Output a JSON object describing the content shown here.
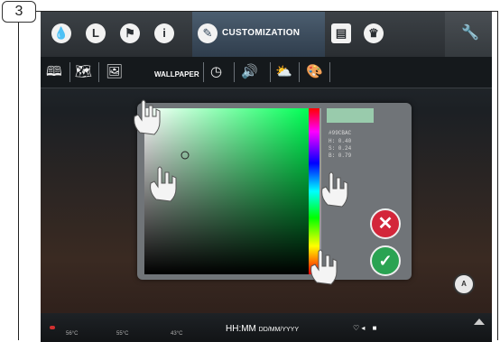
{
  "step": {
    "number": "3"
  },
  "topbar": {
    "tab_label": "CUSTOMIZATION",
    "icons": [
      "water-drop-icon",
      "timer-icon",
      "flag-icon",
      "info-icon",
      "pencil-icon",
      "grid-icon",
      "chef-icon",
      "wrench-icon"
    ]
  },
  "subbar": {
    "wallpaper_label": "WALLPAPER",
    "icons": [
      "book-icon",
      "book-map-icon",
      "wallpaper-icon",
      "clock-icon",
      "speaker-icon",
      "weather-icon",
      "palette-icon"
    ]
  },
  "picker": {
    "hex": "#99CBAC",
    "h": "H: 0.40",
    "s": "S: 0.24",
    "b": "B: 0.79",
    "selected_color": "#99cbac",
    "cancel_glyph": "✕",
    "ok_glyph": "✓"
  },
  "status": {
    "time": "HH:MM",
    "date": "DD/MM/YYYY",
    "temps": [
      "56°C",
      "55°C",
      "43°C"
    ],
    "font_button": "A"
  }
}
